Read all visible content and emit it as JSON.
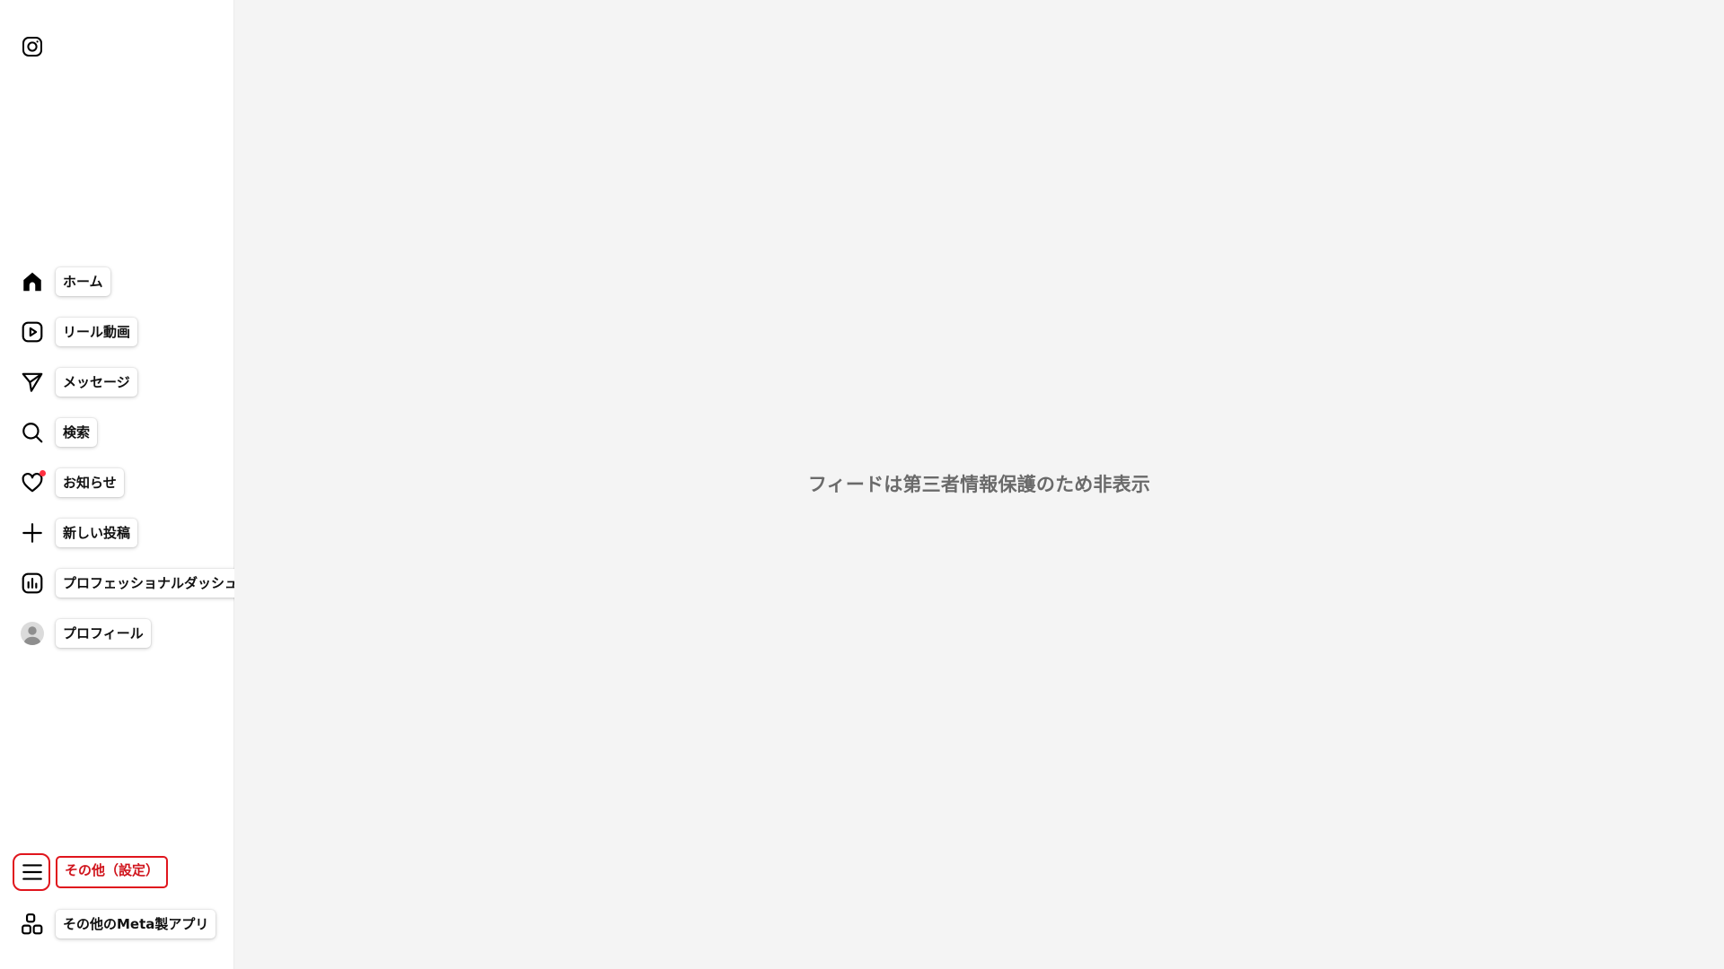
{
  "sidebar": {
    "logo_icon": "instagram-icon",
    "items": [
      {
        "label": "ホーム",
        "icon": "home-icon"
      },
      {
        "label": "リール動画",
        "icon": "reels-icon"
      },
      {
        "label": "メッセージ",
        "icon": "paper-plane-icon"
      },
      {
        "label": "検索",
        "icon": "search-icon"
      },
      {
        "label": "お知らせ",
        "icon": "heart-icon",
        "has_notification_dot": true
      },
      {
        "label": "新しい投稿",
        "icon": "plus-icon"
      },
      {
        "label": "プロフェッショナルダッシュボード",
        "icon": "dashboard-icon"
      },
      {
        "label": "プロフィール",
        "icon": "avatar"
      }
    ],
    "bottom_items": [
      {
        "label": "その他（設定）",
        "icon": "hamburger-menu-icon",
        "highlighted": true
      },
      {
        "label": "その他のMeta製アプリ",
        "icon": "apps-grid-icon"
      }
    ]
  },
  "main": {
    "placeholder_text": "フィードは第三者情報保護のため非表示"
  },
  "colors": {
    "highlight": "#e0151d",
    "notification": "#ff3040",
    "main_background": "#f4f4f4"
  }
}
